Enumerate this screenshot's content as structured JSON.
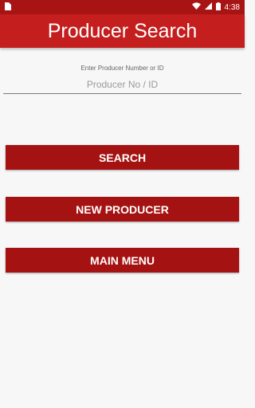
{
  "status_bar": {
    "time": "4:38",
    "icons": [
      "sim-card-icon",
      "wifi-icon",
      "signal-icon",
      "battery-icon"
    ]
  },
  "app_bar": {
    "title": "Producer Search"
  },
  "form": {
    "label": "Enter Producer Number or ID",
    "input_value": "",
    "input_placeholder": "Producer No / ID"
  },
  "buttons": {
    "search": "SEARCH",
    "new_producer": "NEW PRODUCER",
    "main_menu": "MAIN MENU"
  },
  "colors": {
    "status_bar": "#a81414",
    "app_bar": "#c41e1e",
    "button": "#a51212",
    "background": "#f7f7f7"
  }
}
